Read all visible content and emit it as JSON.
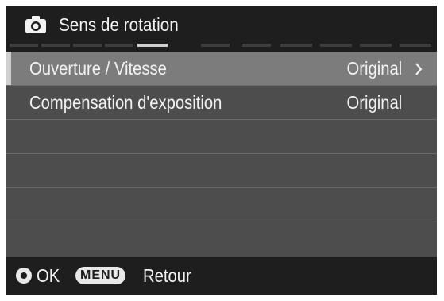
{
  "header": {
    "icon": "camera-icon",
    "title": "Sens de rotation",
    "tabs": {
      "count": 9,
      "active_index": 3
    }
  },
  "menu": {
    "items": [
      {
        "label": "Ouverture / Vitesse",
        "value": "Original",
        "has_submenu": true,
        "selected": true
      },
      {
        "label": "Compensation d'exposition",
        "value": "Original",
        "has_submenu": false,
        "selected": false
      },
      {
        "label": "",
        "value": ""
      },
      {
        "label": "",
        "value": ""
      },
      {
        "label": "",
        "value": ""
      },
      {
        "label": "",
        "value": ""
      }
    ]
  },
  "footer": {
    "ok_icon": "ok-button-icon",
    "ok_label": "OK",
    "menu_badge": "MENU",
    "back_label": "Retour"
  },
  "colors": {
    "header_bg": "#1e1e1e",
    "list_bg": "#4d4d4d",
    "selected_row_bg": "#7c7c7c",
    "text": "#f2f2f2"
  }
}
